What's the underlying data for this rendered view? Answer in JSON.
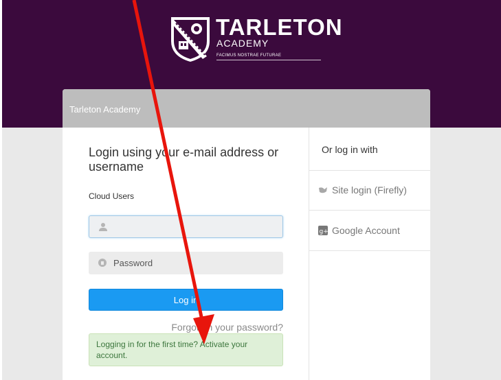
{
  "logo": {
    "name": "TARLETON",
    "subtitle": "ACADEMY",
    "motto": "FACIMUS NOSTRAE FUTURAE"
  },
  "card": {
    "title": "Tarleton Academy"
  },
  "login": {
    "heading": "Login using your e-mail address or username",
    "cloud_label": "Cloud Users",
    "username_placeholder": "",
    "password_placeholder": "Password",
    "login_button": "Log in",
    "forgot_link": "Forgotten your password?",
    "first_time_message": "Logging in for the first time? Activate your account."
  },
  "alternatives": {
    "heading": "Or log in with",
    "items": [
      {
        "label": "Site login (Firefly)",
        "icon": "firefly-icon"
      },
      {
        "label": "Google Account",
        "icon": "google-plus-icon"
      }
    ]
  },
  "colors": {
    "header": "#3b0a3d",
    "button": "#1a9af2",
    "annotation_arrow": "#e8150c",
    "alert_bg": "#dff0d8"
  }
}
